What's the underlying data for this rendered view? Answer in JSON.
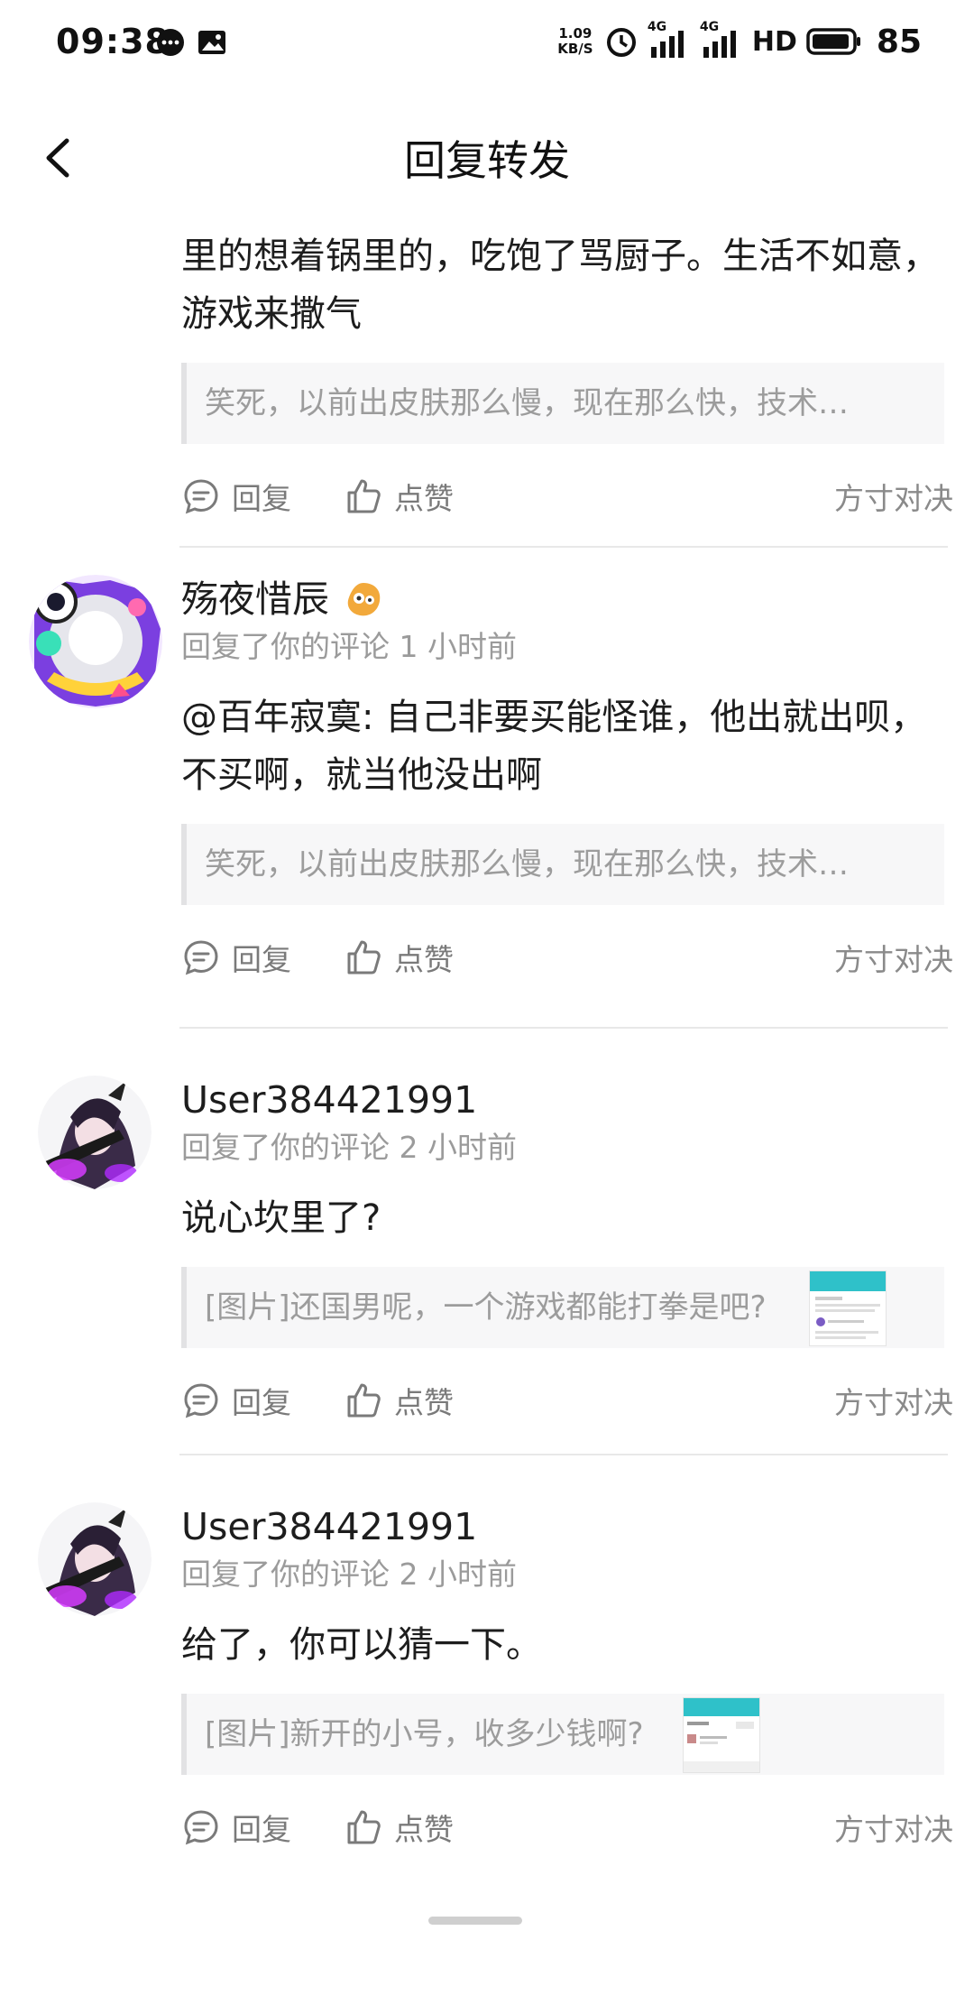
{
  "status_bar": {
    "time": "09:38",
    "net_speed_value": "1.09",
    "net_speed_unit": "KB/S",
    "signal1": "4G",
    "signal2": "4G",
    "hd": "HD",
    "battery": "85"
  },
  "header": {
    "title": "回复转发"
  },
  "actions": {
    "reply": "回复",
    "like": "点赞"
  },
  "items": [
    {
      "text": "里的想着锅里的，吃饱了骂厨子。生活不如意，游戏来撒气",
      "quote": "笑死，以前出皮肤那么慢，现在那么快，技术…",
      "game": "方寸对决"
    },
    {
      "username": "殇夜惜辰",
      "meta": "回复了你的评论 1 小时前",
      "text": "@百年寂寞: 自己非要买能怪谁，他出就出呗，不买啊，就当他没出啊",
      "quote": "笑死，以前出皮肤那么慢，现在那么快，技术…",
      "game": "方寸对决"
    },
    {
      "username": "User384421991",
      "meta": "回复了你的评论 2 小时前",
      "text": "说心坎里了?",
      "quote": "[图片]还国男呢，一个游戏都能打拳是吧?",
      "game": "方寸对决"
    },
    {
      "username": "User384421991",
      "meta": "回复了你的评论 2 小时前",
      "text": "给了，你可以猜一下。",
      "quote": "[图片]新开的小号，收多少钱啊?",
      "game": "方寸对决"
    }
  ]
}
